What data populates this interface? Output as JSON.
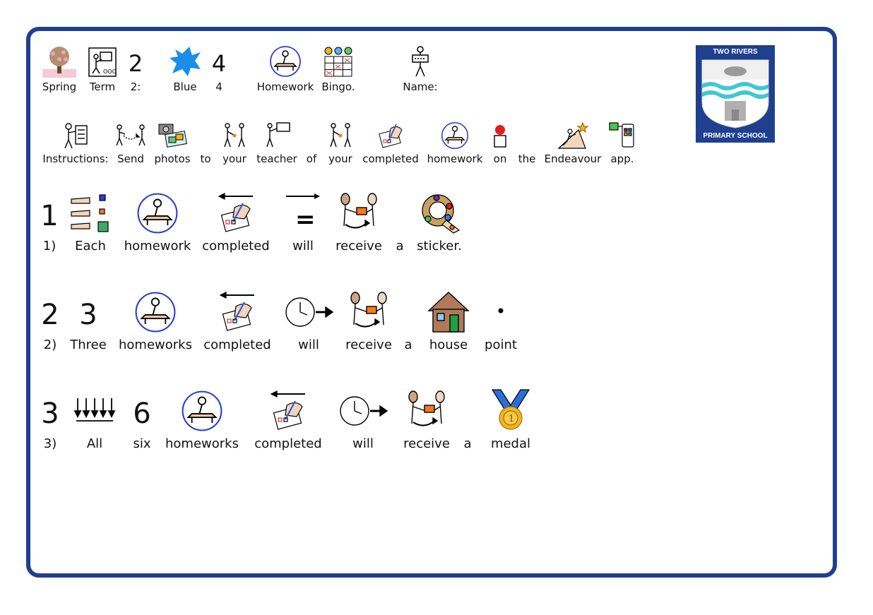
{
  "school_logo": {
    "top_text": "TWO RIVERS",
    "bottom_text": "PRIMARY SCHOOL"
  },
  "header_row": {
    "spring": "Spring",
    "term": "Term",
    "two_num": "2",
    "two_label": "2:",
    "blue": "Blue",
    "four_num": "4",
    "four_label": "4",
    "homework": "Homework",
    "bingo": "Bingo.",
    "name": "Name:"
  },
  "instructions_row": {
    "instructions": "Instructions:",
    "send": "Send",
    "photos": "photos",
    "to": "to",
    "your1": "your",
    "teacher": "teacher",
    "of": "of",
    "your2": "your",
    "completed": "completed",
    "homework": "homework",
    "on": "on",
    "the": "the",
    "endeavour": "Endeavour",
    "app": "app."
  },
  "rule1": {
    "num": "1",
    "index": "1)",
    "each": "Each",
    "homework": "homework",
    "completed": "completed",
    "equals": "=",
    "will": "will",
    "receive": "receive",
    "a": "a",
    "sticker": "sticker."
  },
  "rule2": {
    "num": "2",
    "index": "2)",
    "three_num": "3",
    "three": "Three",
    "homeworks": "homeworks",
    "completed": "completed",
    "will": "will",
    "receive": "receive",
    "a": "a",
    "house": "house",
    "point": "point"
  },
  "rule3": {
    "num": "3",
    "index": "3)",
    "all": "All",
    "six_num": "6",
    "six": "six",
    "homeworks": "homeworks",
    "completed": "completed",
    "will": "will",
    "receive": "receive",
    "a": "a",
    "medal": "medal"
  },
  "colors": {
    "frame": "#1f3f8f",
    "blue_splat": "#1a8ee8",
    "highlight_orange": "#f47a20",
    "house_brown": "#b07a5a",
    "medal_gold": "#f2b51c"
  }
}
